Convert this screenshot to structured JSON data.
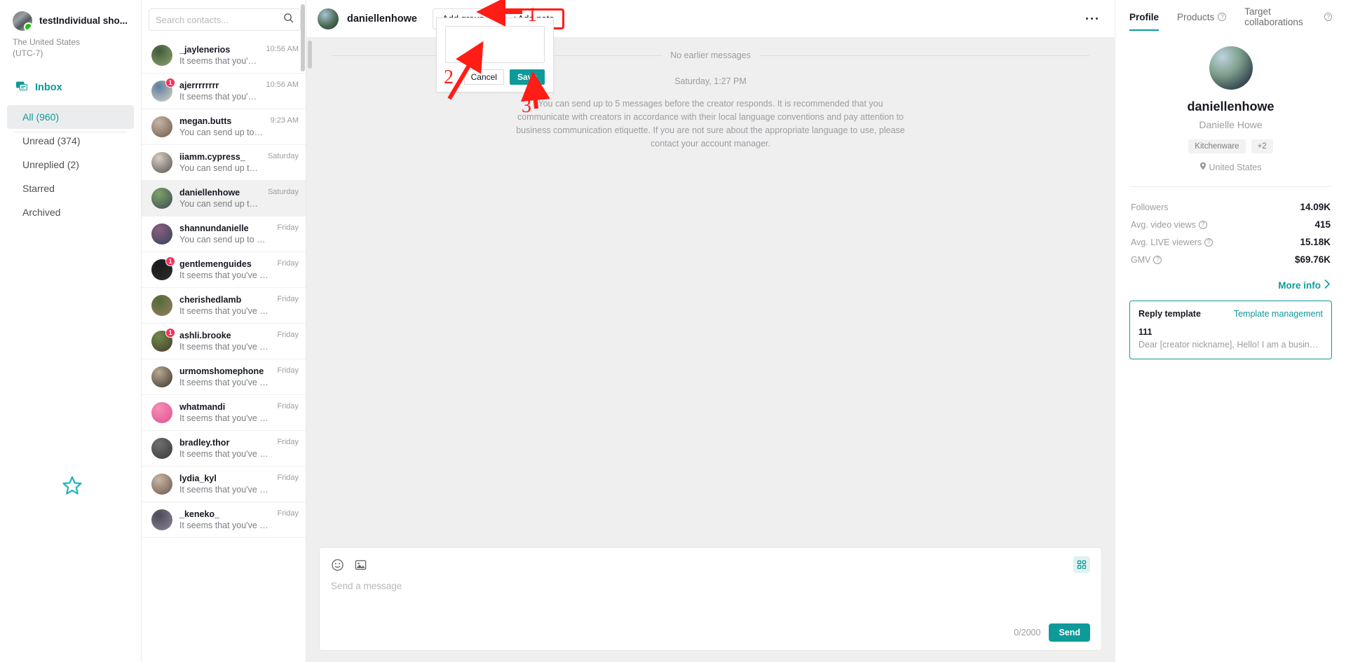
{
  "leftnav": {
    "shop_name": "testIndividual sho...",
    "region": "The United States\n(UTC-7)",
    "region_line1": "The United States",
    "region_line2": "(UTC-7)",
    "inbox_label": "Inbox",
    "items": [
      {
        "label": "All (960)",
        "active": true
      },
      {
        "label": "Unread (374)",
        "active": false
      },
      {
        "label": "Unreplied (2)",
        "active": false
      },
      {
        "label": "Starred",
        "active": false
      },
      {
        "label": "Archived",
        "active": false
      }
    ]
  },
  "search": {
    "placeholder": "Search contacts...",
    "value": "",
    "icon": "search-icon",
    "filter_icon": "filter-sliders-icon"
  },
  "contacts": [
    {
      "name": "_jaylenerios",
      "preview": "It seems that you've sent too ...",
      "time": "10:56 AM",
      "badge": "",
      "active": false,
      "c1": "#3f5a3a",
      "c2": "#8ea36d"
    },
    {
      "name": "ajerrrrrrrr",
      "preview": "It seems that you've sent too ...",
      "time": "10:56 AM",
      "badge": "1",
      "active": false,
      "c1": "#5d7ea0",
      "c2": "#d8d2c4"
    },
    {
      "name": "megan.butts",
      "preview": "You can send up to 5 messag...",
      "time": "9:23 AM",
      "badge": "",
      "active": false,
      "c1": "#c6b5a4",
      "c2": "#6e5a4b"
    },
    {
      "name": "iiamm.cypress_",
      "preview": "You can send up to 5 messag...",
      "time": "Saturday",
      "badge": "",
      "active": false,
      "c1": "#d8cfc6",
      "c2": "#55504c"
    },
    {
      "name": "daniellenhowe",
      "preview": "You can send up to 5 messag...",
      "time": "Saturday",
      "badge": "",
      "active": true,
      "c1": "#7fa26a",
      "c2": "#3b4a52"
    },
    {
      "name": "shannundanielle",
      "preview": "You can send up to 5 messag...",
      "time": "Friday",
      "badge": "",
      "active": false,
      "c1": "#8a5f7d",
      "c2": "#36445e"
    },
    {
      "name": "gentlemenguides",
      "preview": "It seems that you've sent too ...",
      "time": "Friday",
      "badge": "1",
      "active": false,
      "c1": "#1a1a1a",
      "c2": "#2e2e2e"
    },
    {
      "name": "cherishedlamb",
      "preview": "It seems that you've sent too ...",
      "time": "Friday",
      "badge": "",
      "active": false,
      "c1": "#4e6b3c",
      "c2": "#9c7d5c"
    },
    {
      "name": "ashli.brooke",
      "preview": "It seems that you've sent too ...",
      "time": "Friday",
      "badge": "1",
      "active": false,
      "c1": "#6f8a4a",
      "c2": "#4a3a2c"
    },
    {
      "name": "urmomshomephone",
      "preview": "It seems that you've sent too ...",
      "time": "Friday",
      "badge": "",
      "active": false,
      "c1": "#b9a98f",
      "c2": "#3a3530"
    },
    {
      "name": "whatmandi",
      "preview": "It seems that you've sent too ...",
      "time": "Friday",
      "badge": "",
      "active": false,
      "c1": "#f48fb6",
      "c2": "#e24f8e"
    },
    {
      "name": "bradley.thor",
      "preview": "It seems that you've sent too ...",
      "time": "Friday",
      "badge": "",
      "active": false,
      "c1": "#6d6e70",
      "c2": "#3c3a38"
    },
    {
      "name": "lydia_kyl",
      "preview": "It seems that you've sent too ...",
      "time": "Friday",
      "badge": "",
      "active": false,
      "c1": "#c8b6a6",
      "c2": "#6b5747"
    },
    {
      "name": "_keneko_",
      "preview": "It seems that you've sent too ...",
      "time": "Friday",
      "badge": "",
      "active": false,
      "c1": "#4c4a57",
      "c2": "#8d8496"
    }
  ],
  "chat_header": {
    "title": "daniellenhowe",
    "add_group_label": "Add group",
    "add_note_label": "+Add note",
    "more_icon": "more-horizontal-icon"
  },
  "conversation": {
    "no_earlier": "No earlier messages",
    "day_separator": "Saturday, 1:27 PM",
    "notice": "You can send up to 5 messages before the creator responds. It is recommended that you communicate with creators in accordance with their local language conventions and pay attention to business communication etiquette. If you are not sure about the appropriate language to use, please contact your account manager."
  },
  "note_popup": {
    "value": "",
    "placeholder": "",
    "cancel_label": "Cancel",
    "save_label": "Save"
  },
  "annotations": [
    {
      "label": "1"
    },
    {
      "label": "2"
    },
    {
      "label": "3"
    }
  ],
  "composer": {
    "placeholder": "Send a message",
    "value": "",
    "counter": "0/2000",
    "send_label": "Send",
    "emoji_icon": "emoji-smiley-icon",
    "image_icon": "image-upload-icon",
    "quick_icon": "quick-reply-grid-icon"
  },
  "right_panel": {
    "tabs": [
      {
        "label": "Profile",
        "active": true,
        "help": false
      },
      {
        "label": "Products",
        "active": false,
        "help": true
      },
      {
        "label": "Target collaborations",
        "active": false,
        "help": true
      }
    ],
    "profile": {
      "handle": "daniellenhowe",
      "real_name": "Danielle Howe",
      "tags": [
        "Kitchenware",
        "+2"
      ],
      "location": "United States",
      "location_icon": "location-pin-icon"
    },
    "stats": [
      {
        "label": "Followers",
        "value": "14.09K",
        "help": false
      },
      {
        "label": "Avg. video views",
        "value": "415",
        "help": true
      },
      {
        "label": "Avg. LIVE viewers",
        "value": "15.18K",
        "help": true
      },
      {
        "label": "GMV",
        "value": "$69.76K",
        "help": true
      }
    ],
    "more_info_label": "More info",
    "reply_template": {
      "title": "Reply template",
      "manage_label": "Template management",
      "name": "111",
      "body": "Dear [creator nickname], Hello! I am a business ow..."
    }
  },
  "colors": {
    "accent": "#0f9a9a",
    "annotation_red": "#ff1d15",
    "badge_red": "#fe2c55",
    "chat_bg": "#efeff0"
  }
}
